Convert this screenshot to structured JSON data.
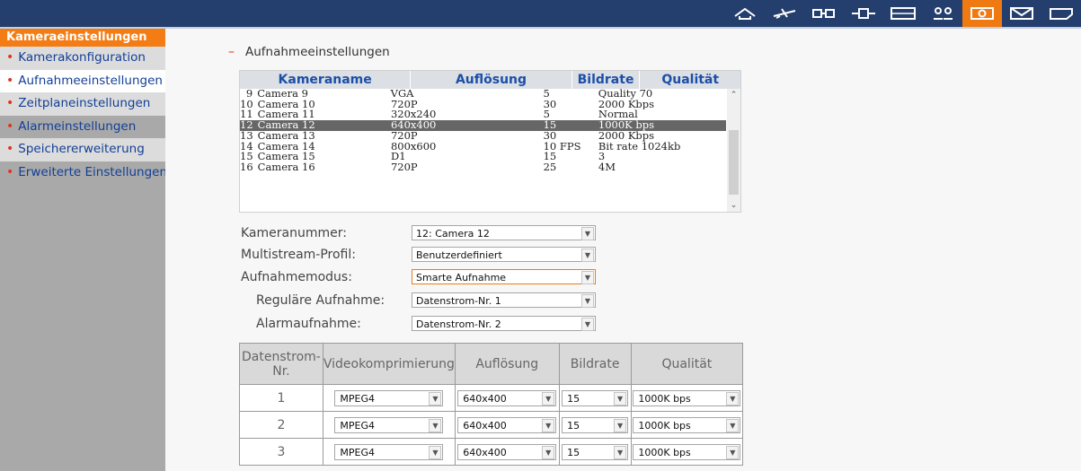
{
  "topbar": {
    "icons": [
      "home-icon",
      "plane-icon",
      "camera-config-icon",
      "network-icon",
      "monitor-icon",
      "users-icon",
      "camera-settings-icon",
      "mail-icon",
      "folder-icon"
    ],
    "active_icon": "camera-settings-icon",
    "bg_color": "#243f6e",
    "active_color": "#f07a12"
  },
  "sidebar": {
    "header": "Kameraeinstellungen",
    "items": [
      {
        "label": "Kamerakonfiguration"
      },
      {
        "label": "Aufnahmeeinstellungen"
      },
      {
        "label": "Zeitplaneinstellungen"
      },
      {
        "label": "Alarmeinstellungen"
      },
      {
        "label": "Speichererweiterung"
      },
      {
        "label": "Erweiterte Einstellungen"
      }
    ],
    "selected_item": "Aufnahmeeinstellungen"
  },
  "main": {
    "section_title": "Aufnahmeeinstellungen",
    "camera_table": {
      "headers": [
        "Kameraname",
        "Auflösung",
        "Bildrate",
        "Qualität"
      ],
      "rows": [
        {
          "num": "9",
          "name": "Camera 9",
          "res": "VGA",
          "fps": "5",
          "quality": "Quality 70"
        },
        {
          "num": "10",
          "name": "Camera 10",
          "res": "720P",
          "fps": "30",
          "quality": "2000 Kbps"
        },
        {
          "num": "11",
          "name": "Camera 11",
          "res": "320x240",
          "fps": "5",
          "quality": "Normal"
        },
        {
          "num": "12",
          "name": "Camera 12",
          "res": "640x400",
          "fps": "15",
          "quality": "1000K bps"
        },
        {
          "num": "13",
          "name": "Camera 13",
          "res": "720P",
          "fps": "30",
          "quality": "2000 Kbps"
        },
        {
          "num": "14",
          "name": "Camera 14",
          "res": "800x600",
          "fps": "10 FPS",
          "quality": "Bit rate 1024kb"
        },
        {
          "num": "15",
          "name": "Camera 15",
          "res": "D1",
          "fps": "15",
          "quality": "3"
        },
        {
          "num": "16",
          "name": "Camera 16",
          "res": "720P",
          "fps": "25",
          "quality": "4M"
        }
      ],
      "selected_row": "12"
    },
    "form": {
      "camera_number": {
        "label": "Kameranummer:",
        "value": "12: Camera 12"
      },
      "multistream_profile": {
        "label": "Multistream-Profil:",
        "value": "Benutzerdefiniert"
      },
      "recording_mode": {
        "label": "Aufnahmemodus:",
        "value": "Smarte Aufnahme"
      },
      "regular_recording": {
        "label": "Reguläre Aufnahme:",
        "value": "Datenstrom-Nr. 1"
      },
      "alarm_recording": {
        "label": "Alarmaufnahme:",
        "value": "Datenstrom-Nr. 2"
      }
    },
    "stream_table": {
      "headers": [
        "Datenstrom-Nr.",
        "Videokomprimierung",
        "Auflösung",
        "Bildrate",
        "Qualität"
      ],
      "rows": [
        {
          "num": "1",
          "codec": "MPEG4",
          "res": "640x400",
          "fps": "15",
          "quality": "1000K bps"
        },
        {
          "num": "2",
          "codec": "MPEG4",
          "res": "640x400",
          "fps": "15",
          "quality": "1000K bps"
        },
        {
          "num": "3",
          "codec": "MPEG4",
          "res": "640x400",
          "fps": "15",
          "quality": "1000K bps"
        }
      ]
    }
  }
}
